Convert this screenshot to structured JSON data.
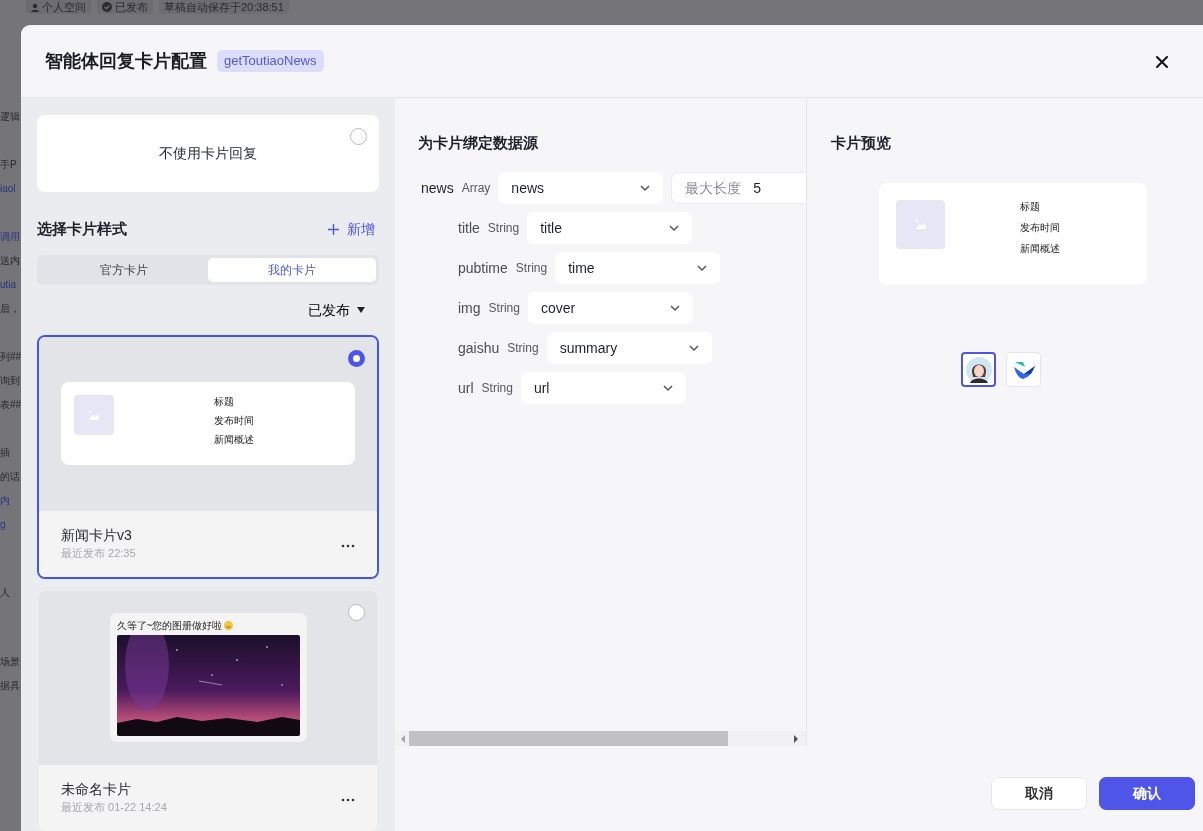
{
  "background_page": {
    "chips": [
      {
        "kind": "person",
        "label": "个人空间"
      },
      {
        "kind": "check",
        "label": "已发布"
      },
      {
        "kind": "plain",
        "label": "草稿自动保存于20:38:51"
      }
    ],
    "fragment_groups": [
      [
        {
          "text": "逻辑",
          "link": false
        }
      ],
      [
        {
          "text": "手P",
          "link": false
        },
        {
          "text": "iaol",
          "link": true
        }
      ],
      [
        {
          "text": "调用",
          "link": true
        },
        {
          "text": "送内",
          "link": false
        },
        {
          "text": "utia",
          "link": true
        },
        {
          "text": "后，",
          "link": false
        }
      ],
      [
        {
          "text": "列##",
          "link": false
        },
        {
          "text": "询到",
          "link": false
        },
        {
          "text": "表##",
          "link": false
        }
      ],
      [
        {
          "text": "插",
          "link": false
        },
        {
          "text": "的话",
          "link": false
        },
        {
          "text": "内",
          "link": true
        },
        {
          "text": "g",
          "link": true
        }
      ],
      [
        {
          "text": "人",
          "link": false
        }
      ],
      [
        {
          "text": "场景",
          "link": false
        },
        {
          "text": "据具",
          "link": false
        }
      ]
    ]
  },
  "dialog": {
    "title": "智能体回复卡片配置",
    "tag": "getToutiaoNews"
  },
  "no_card_option": {
    "label": "不使用卡片回复",
    "selected": false
  },
  "style_section": {
    "title": "选择卡片样式",
    "add_label": "新增"
  },
  "source_tabs": [
    {
      "label": "官方卡片",
      "selected": false
    },
    {
      "label": "我的卡片",
      "selected": true
    }
  ],
  "filter": "已发布",
  "cards": [
    {
      "kind": "news",
      "name": "新闻卡片v3",
      "published": "最近发布 22:35",
      "selected": true,
      "preview_lines": [
        "标题",
        "发布时间",
        "新闻概述"
      ]
    },
    {
      "kind": "album",
      "name": "未命名卡片",
      "published": "最近发布 01-22 14:24",
      "selected": false,
      "preview_caption": "久等了~您的图册做好啦"
    }
  ],
  "binding": {
    "title": "为卡片绑定数据源",
    "root": {
      "field": "news",
      "type": "Array",
      "value": "news",
      "max_length_label": "最大长度",
      "max_length": "5",
      "children": [
        {
          "field": "title",
          "type": "String",
          "value": "title"
        },
        {
          "field": "pubtime",
          "type": "String",
          "value": "time"
        },
        {
          "field": "img",
          "type": "String",
          "value": "cover"
        },
        {
          "field": "gaishu",
          "type": "String",
          "value": "summary"
        },
        {
          "field": "url",
          "type": "String",
          "value": "url"
        }
      ]
    }
  },
  "preview": {
    "title": "卡片预览",
    "lines": [
      "标题",
      "发布时间",
      "新闻概述"
    ],
    "thumbs": [
      {
        "kind": "avatar",
        "selected": true
      },
      {
        "kind": "logo",
        "selected": false
      }
    ]
  },
  "buttons": [
    {
      "kind": "secondary",
      "label": "取消"
    },
    {
      "kind": "primary",
      "label": "确认"
    }
  ]
}
